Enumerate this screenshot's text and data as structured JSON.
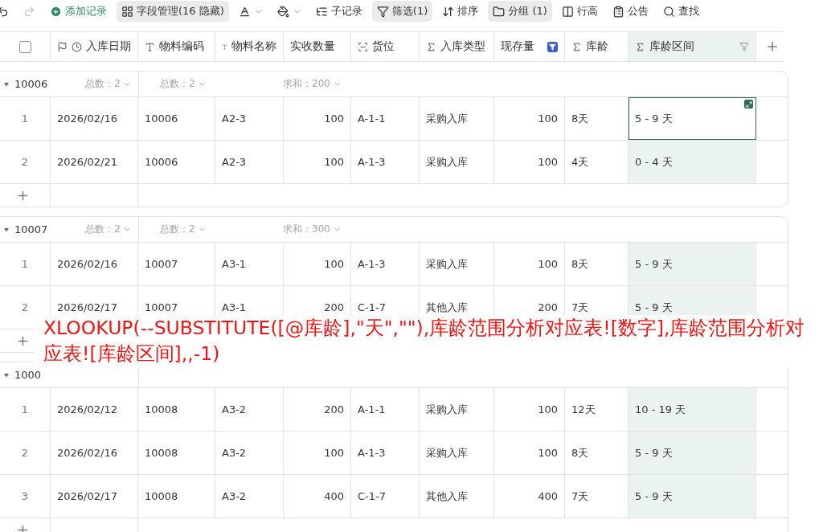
{
  "toolbar": [
    {
      "kind": "icon",
      "disabled": false
    },
    {
      "kind": "icon",
      "disabled": true
    },
    {
      "kind": "primary",
      "label": "添加记录"
    },
    {
      "kind": "button",
      "label": "字段管理(16 隐藏)",
      "active": true
    },
    {
      "kind": "menu"
    },
    {
      "kind": "menu"
    },
    {
      "kind": "button",
      "label": "子记录",
      "active": false
    },
    {
      "kind": "button",
      "label": "筛选(1)",
      "active": true
    },
    {
      "kind": "button",
      "label": "排序",
      "active": false
    },
    {
      "kind": "button",
      "label": "分组 (1)",
      "active": true
    },
    {
      "kind": "button",
      "label": "行高",
      "active": false
    },
    {
      "kind": "button",
      "label": "公告",
      "active": false
    },
    {
      "kind": "button",
      "label": "查找",
      "active": false
    }
  ],
  "columns": [
    {
      "kind": "check",
      "checked": false,
      "highlighted": false
    },
    {
      "kind": "text",
      "label": "入库日期",
      "highlighted": false
    },
    {
      "kind": "text",
      "label": "物料编码",
      "highlighted": false
    },
    {
      "kind": "text",
      "label": "物料名称",
      "highlighted": false
    },
    {
      "kind": "number",
      "label": "实收数量",
      "highlighted": false
    },
    {
      "kind": "text",
      "label": "货位",
      "highlighted": false
    },
    {
      "kind": "text",
      "label": "入库类型",
      "highlighted": false
    },
    {
      "kind": "number",
      "label": "现存量",
      "highlighted": false,
      "filtered": true
    },
    {
      "kind": "text",
      "label": "库龄",
      "highlighted": false
    },
    {
      "kind": "text",
      "label": "库龄区间",
      "highlighted": true,
      "filtered": false
    }
  ],
  "groups": [
    {
      "label": "10006",
      "expanded": true,
      "summaries": [
        {
          "kind": "group_count",
          "text": "总数：2"
        },
        {
          "kind": "count",
          "text": "总数：2"
        },
        {
          "kind": "sum",
          "text": "求和：200"
        }
      ],
      "rows": [
        {
          "index": "1",
          "focused": true,
          "cells": [
            "2026/02/16",
            "10006",
            "A2-3",
            "100",
            "A-1-1",
            "采购入库",
            "100",
            "8天",
            "5 - 9 天"
          ]
        },
        {
          "index": "2",
          "focused": false,
          "cells": [
            "2026/02/21",
            "10006",
            "A2-3",
            "100",
            "A-1-3",
            "采购入库",
            "100",
            "4天",
            "0 - 4 天"
          ]
        }
      ]
    },
    {
      "label": "10007",
      "expanded": true,
      "summaries": [
        {
          "kind": "group_count",
          "text": "总数：2"
        },
        {
          "kind": "count",
          "text": "总数：2"
        },
        {
          "kind": "sum",
          "text": "求和：300"
        }
      ],
      "rows": [
        {
          "index": "1",
          "focused": false,
          "cells": [
            "2026/02/16",
            "10007",
            "A3-1",
            "100",
            "A-1-3",
            "采购入库",
            "100",
            "8天",
            "5 - 9 天"
          ]
        },
        {
          "index": "2",
          "focused": false,
          "cells": [
            "2026/02/17",
            "10007",
            "A3-1",
            "200",
            "C-1-7",
            "其他入库",
            "200",
            "7天",
            "5 - 9 天"
          ]
        }
      ]
    },
    {
      "label": "1000",
      "expanded": true,
      "rows": [
        {
          "index": "1",
          "focused": false,
          "cells": [
            "2026/02/12",
            "10008",
            "A3-2",
            "200",
            "A-1-1",
            "采购入库",
            "100",
            "12天",
            "10 - 19 天"
          ]
        },
        {
          "index": "2",
          "focused": false,
          "cells": [
            "2026/02/16",
            "10008",
            "A3-2",
            "100",
            "A-1-3",
            "采购入库",
            "100",
            "8天",
            "5 - 9 天"
          ]
        },
        {
          "index": "3",
          "focused": false,
          "cells": [
            "2026/02/17",
            "10008",
            "A3-2",
            "400",
            "C-1-7",
            "其他入库",
            "400",
            "7天",
            "5 - 9 天"
          ]
        }
      ]
    }
  ],
  "annotation": {
    "text": "XLOOKUP(--SUBSTITUTE([@库龄],\"天\",\"\"),库龄范围分析对应表![数字],库龄范围分析对应表![库龄区间],,-1)"
  }
}
